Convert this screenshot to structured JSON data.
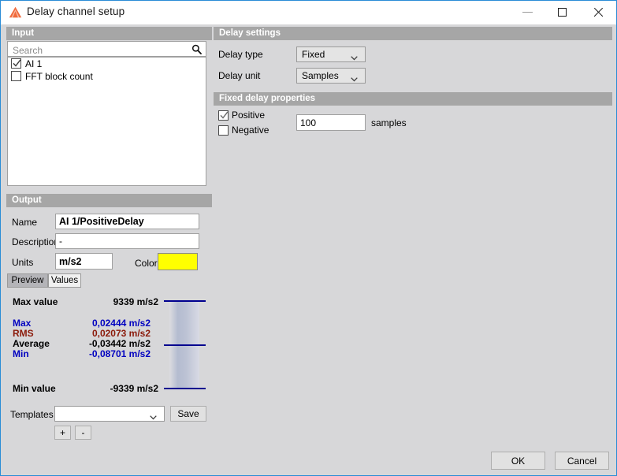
{
  "window": {
    "title": "Delay channel setup",
    "icon": "dewesoft-triangle-icon",
    "minimize_label": "",
    "maximize_label": "",
    "close_label": "",
    "border_color": "#2a8cd6",
    "background": "#d7d7d9"
  },
  "input_panel": {
    "header": "Input",
    "search": {
      "placeholder": "Search",
      "value": "",
      "icon": "search-icon"
    },
    "items": [
      {
        "label": "AI 1",
        "checked": true
      },
      {
        "label": "FFT block count",
        "checked": false
      }
    ]
  },
  "delay_settings": {
    "header": "Delay settings",
    "delay_type": {
      "label": "Delay type",
      "value": "Fixed",
      "options": [
        "Fixed"
      ]
    },
    "delay_unit": {
      "label": "Delay unit",
      "value": "Samples",
      "options": [
        "Samples"
      ]
    }
  },
  "fixed_delay": {
    "header": "Fixed delay properties",
    "positive": {
      "label": "Positive",
      "checked": true
    },
    "negative": {
      "label": "Negative",
      "checked": false
    },
    "amount": {
      "value": "100",
      "unit": "samples"
    }
  },
  "output": {
    "header": "Output",
    "name": {
      "label": "Name",
      "value": "AI 1/PositiveDelay"
    },
    "description": {
      "label": "Description",
      "value": "-"
    },
    "units": {
      "label": "Units",
      "value": "m/s2"
    },
    "color": {
      "label": "Color",
      "value": "#ffff00"
    },
    "tabs": [
      {
        "label": "Preview",
        "active": true
      },
      {
        "label": "Values",
        "active": false
      }
    ]
  },
  "preview": {
    "max_value_label": "Max value",
    "max_value": "9339 m/s2",
    "min_value_label": "Min value",
    "min_value": "-9339 m/s2",
    "stats": [
      {
        "name": "Max",
        "value": "0,02444 m/s2",
        "color": "#0000c0"
      },
      {
        "name": "RMS",
        "value": "0,02073 m/s2",
        "color": "#8b1a0a"
      },
      {
        "name": "Average",
        "value": "-0,03442 m/s2",
        "color": "#000000"
      },
      {
        "name": "Min",
        "value": "-0,08701 m/s2",
        "color": "#0000c0"
      }
    ]
  },
  "templates": {
    "label": "Templates",
    "value": "",
    "save_label": "Save",
    "add_label": "+",
    "remove_label": "-"
  },
  "footer": {
    "ok_label": "OK",
    "cancel_label": "Cancel"
  }
}
